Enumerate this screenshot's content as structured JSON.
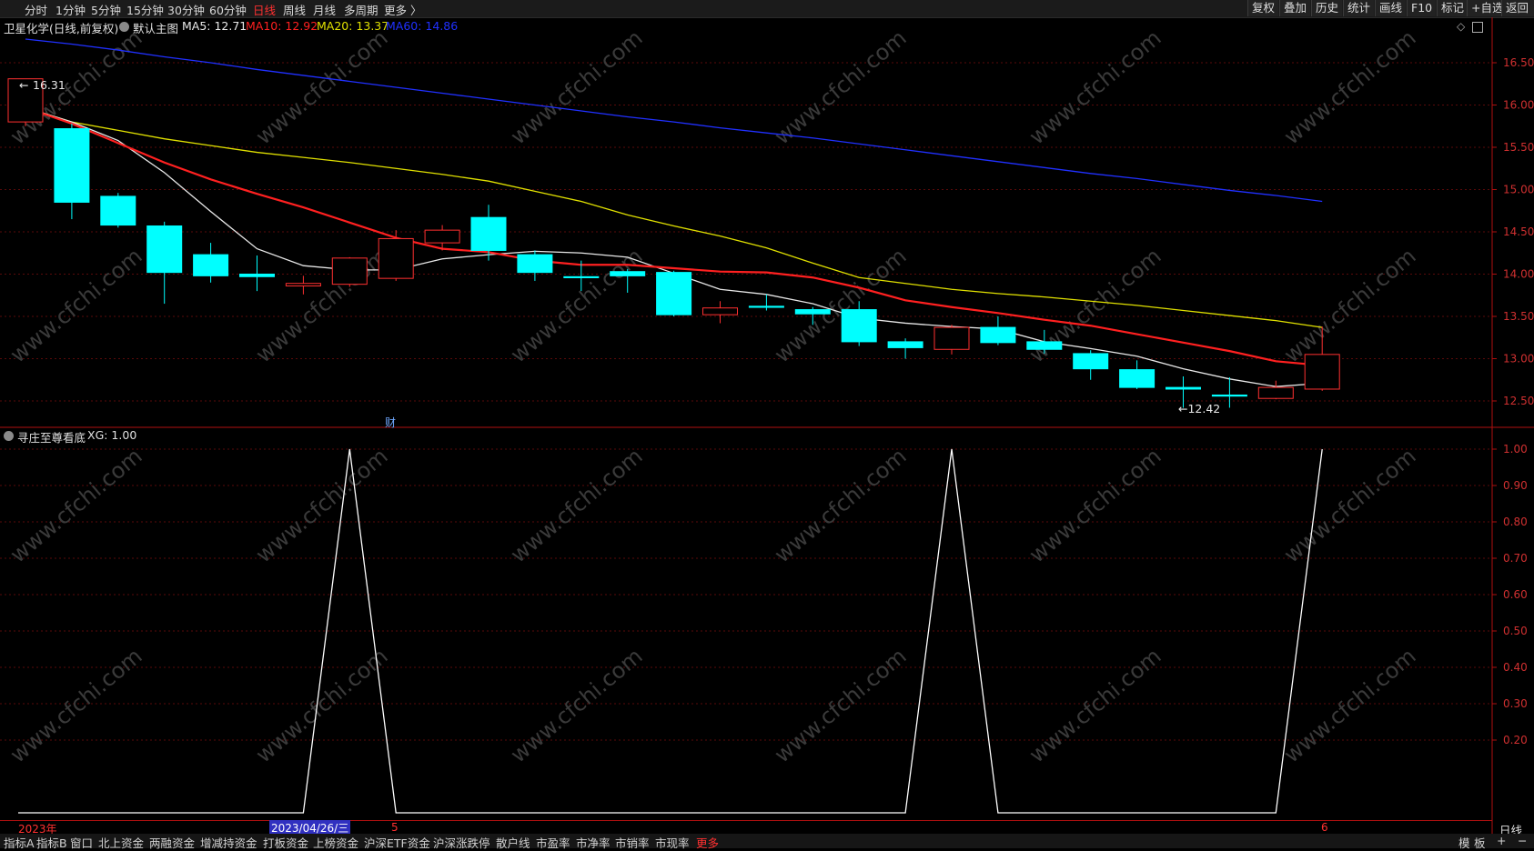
{
  "toolbar": {
    "periods": [
      "分时",
      "1分钟",
      "5分钟",
      "15分钟",
      "30分钟",
      "60分钟",
      "日线",
      "周线",
      "月线",
      "多周期",
      "更多 〉"
    ],
    "active_period": "日线",
    "right_buttons": [
      "复权",
      "叠加",
      "历史",
      "统计",
      "画线",
      "F10",
      "标记",
      "+自选",
      "返回"
    ]
  },
  "main_legend": {
    "title": "卫星化学(日线,前复权)",
    "template": "默认主图",
    "ma5": "MA5: 12.71",
    "ma10": "MA10: 12.92",
    "ma20": "MA20: 13.37",
    "ma60": "MA60: 14.86"
  },
  "sub_legend": {
    "title": "寻庄至尊看底",
    "xg": "XG: 1.00"
  },
  "annotations": {
    "high_label": "16.31",
    "low_label": "←12.42",
    "fin_marker": "财"
  },
  "axes": {
    "price_ticks": [
      "16.50",
      "16.00",
      "15.50",
      "15.00",
      "14.50",
      "14.00",
      "13.50",
      "13.00",
      "12.50"
    ],
    "xg_ticks": [
      "1.00",
      "0.90",
      "0.80",
      "0.70",
      "0.60",
      "0.50",
      "0.40",
      "0.30",
      "0.20"
    ]
  },
  "timeline": {
    "year_label": "2023年",
    "cursor_date": "2023/04/26/三",
    "month_5": "5",
    "month_6": "6",
    "period_label": "日线"
  },
  "bottom_tabs": [
    "指标A",
    "指标B",
    "窗口",
    "北上资金",
    "两融资金",
    "增减持资金",
    "打板资金",
    "上榜资金",
    "沪深ETF资金",
    "沪深涨跌停",
    "散户线",
    "市盈率",
    "市净率",
    "市销率",
    "市现率",
    "更多"
  ],
  "bottom_right": [
    "模",
    "板",
    "+",
    "−"
  ],
  "watermark": "www.cfchi.com",
  "colors": {
    "bull_up": "#ff3030",
    "bear_down": "#00ffff",
    "ma5": "#e8e8e8",
    "ma10": "#ff2020",
    "ma20": "#e0e000",
    "ma60": "#2030ff",
    "xg_line": "#ffffff",
    "axis_red": "#b01010"
  },
  "chart_data": [
    {
      "type": "candlestick",
      "title": "卫星化学(日线,前复权)",
      "ylim": [
        12.2,
        16.8
      ],
      "candles": [
        {
          "o": 15.8,
          "c": 16.31,
          "h": 16.31,
          "l": 15.75
        },
        {
          "o": 15.72,
          "c": 14.85,
          "h": 15.78,
          "l": 14.65
        },
        {
          "o": 14.92,
          "c": 14.58,
          "h": 14.96,
          "l": 14.55
        },
        {
          "o": 14.57,
          "c": 14.02,
          "h": 14.62,
          "l": 13.65
        },
        {
          "o": 14.23,
          "c": 13.98,
          "h": 14.37,
          "l": 13.9
        },
        {
          "o": 14.0,
          "c": 13.97,
          "h": 14.22,
          "l": 13.8
        },
        {
          "o": 13.86,
          "c": 13.89,
          "h": 13.98,
          "l": 13.76
        },
        {
          "o": 13.88,
          "c": 14.19,
          "h": 14.2,
          "l": 13.85
        },
        {
          "o": 13.95,
          "c": 14.42,
          "h": 14.52,
          "l": 13.92
        },
        {
          "o": 14.37,
          "c": 14.52,
          "h": 14.58,
          "l": 14.28
        },
        {
          "o": 14.67,
          "c": 14.28,
          "h": 14.82,
          "l": 14.16
        },
        {
          "o": 14.23,
          "c": 14.02,
          "h": 14.28,
          "l": 13.92
        },
        {
          "o": 13.97,
          "c": 13.96,
          "h": 14.16,
          "l": 13.8
        },
        {
          "o": 14.03,
          "c": 13.98,
          "h": 14.06,
          "l": 13.78
        },
        {
          "o": 14.02,
          "c": 13.52,
          "h": 14.04,
          "l": 13.5
        },
        {
          "o": 13.52,
          "c": 13.6,
          "h": 13.68,
          "l": 13.42
        },
        {
          "o": 13.62,
          "c": 13.61,
          "h": 13.76,
          "l": 13.57
        },
        {
          "o": 13.58,
          "c": 13.53,
          "h": 13.61,
          "l": 13.4
        },
        {
          "o": 13.58,
          "c": 13.2,
          "h": 13.68,
          "l": 13.15
        },
        {
          "o": 13.2,
          "c": 13.13,
          "h": 13.24,
          "l": 13.0
        },
        {
          "o": 13.11,
          "c": 13.37,
          "h": 13.4,
          "l": 13.05
        },
        {
          "o": 13.37,
          "c": 13.19,
          "h": 13.5,
          "l": 13.16
        },
        {
          "o": 13.2,
          "c": 13.11,
          "h": 13.34,
          "l": 13.06
        },
        {
          "o": 13.06,
          "c": 12.88,
          "h": 13.1,
          "l": 12.75
        },
        {
          "o": 12.87,
          "c": 12.66,
          "h": 12.98,
          "l": 12.64
        },
        {
          "o": 12.66,
          "c": 12.64,
          "h": 12.79,
          "l": 12.42
        },
        {
          "o": 12.57,
          "c": 12.56,
          "h": 12.78,
          "l": 12.42
        },
        {
          "o": 12.53,
          "c": 12.66,
          "h": 12.74,
          "l": 12.52
        },
        {
          "o": 12.64,
          "c": 13.05,
          "h": 13.38,
          "l": 12.62
        }
      ],
      "series": [
        {
          "name": "MA5",
          "values": [
            15.97,
            15.8,
            15.58,
            15.2,
            14.74,
            14.3,
            14.1,
            14.05,
            14.05,
            14.18,
            14.23,
            14.27,
            14.25,
            14.2,
            14.01,
            13.82,
            13.76,
            13.65,
            13.48,
            13.42,
            13.38,
            13.35,
            13.2,
            13.12,
            13.03,
            12.88,
            12.76,
            12.67,
            12.71
          ]
        },
        {
          "name": "MA10",
          "values": [
            15.97,
            15.78,
            15.55,
            15.32,
            15.12,
            14.95,
            14.79,
            14.61,
            14.43,
            14.3,
            14.26,
            14.16,
            14.11,
            14.11,
            14.07,
            14.03,
            14.02,
            13.96,
            13.84,
            13.69,
            13.61,
            13.54,
            13.46,
            13.39,
            13.29,
            13.19,
            13.09,
            12.97,
            12.92
          ]
        },
        {
          "name": "MA20",
          "values": [
            15.97,
            15.8,
            15.7,
            15.6,
            15.52,
            15.44,
            15.38,
            15.32,
            15.25,
            15.18,
            15.1,
            14.98,
            14.86,
            14.7,
            14.57,
            14.45,
            14.31,
            14.13,
            13.96,
            13.89,
            13.82,
            13.77,
            13.73,
            13.68,
            13.63,
            13.57,
            13.51,
            13.45,
            13.37
          ]
        },
        {
          "name": "MA60",
          "values": [
            16.78,
            16.72,
            16.65,
            16.57,
            16.5,
            16.42,
            16.35,
            16.28,
            16.21,
            16.14,
            16.07,
            16.0,
            15.93,
            15.86,
            15.8,
            15.73,
            15.67,
            15.61,
            15.54,
            15.47,
            15.4,
            15.33,
            15.26,
            15.19,
            15.13,
            15.06,
            14.99,
            14.93,
            14.86
          ]
        }
      ]
    },
    {
      "type": "line",
      "title": "寻庄至尊看底",
      "ylim": [
        0,
        1.05
      ],
      "series": [
        {
          "name": "XG",
          "values": [
            0,
            0,
            0,
            0,
            0,
            0,
            0,
            1,
            0,
            0,
            0,
            0,
            0,
            0,
            0,
            0,
            0,
            0,
            0,
            0,
            1,
            0,
            0,
            0,
            0,
            0,
            0,
            0,
            1
          ]
        }
      ]
    }
  ]
}
